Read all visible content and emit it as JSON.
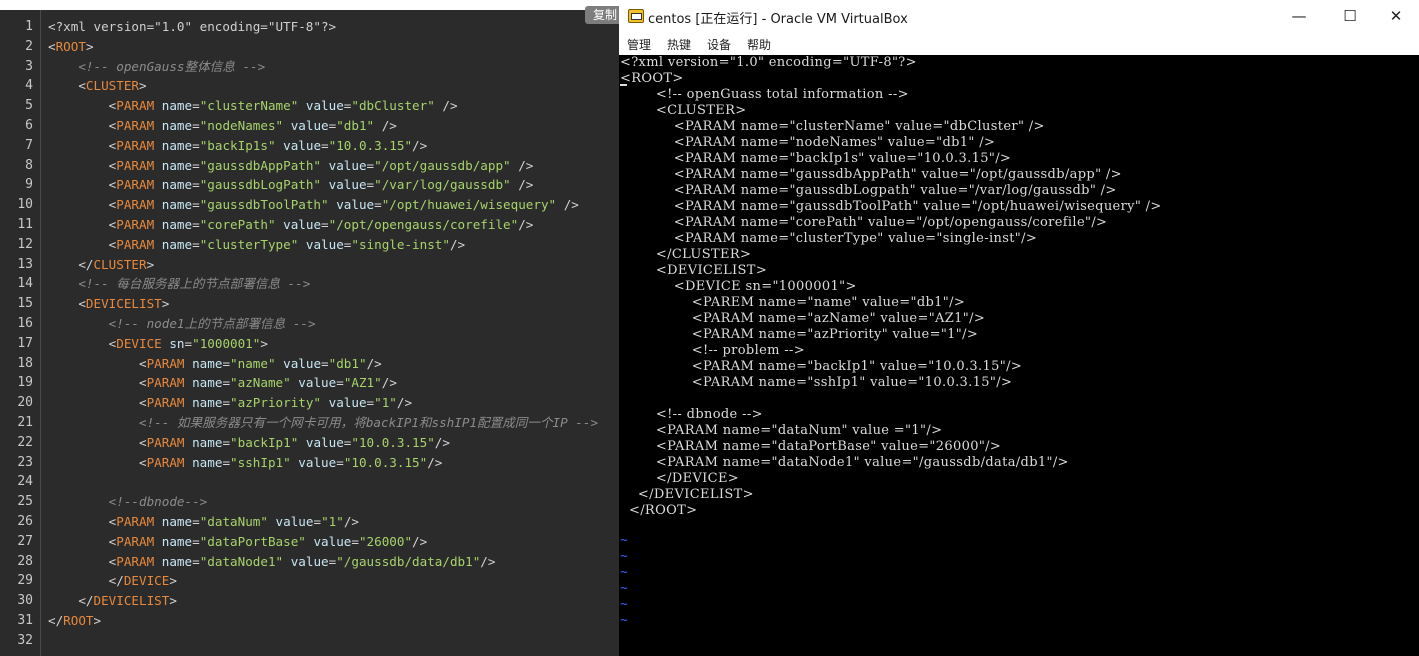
{
  "editor": {
    "copy_label": "复制",
    "line_numbers": [
      "1",
      "2",
      "3",
      "4",
      "5",
      "6",
      "7",
      "8",
      "9",
      "10",
      "11",
      "12",
      "13",
      "14",
      "15",
      "16",
      "17",
      "18",
      "19",
      "20",
      "21",
      "22",
      "23",
      "24",
      "25",
      "26",
      "27",
      "28",
      "29",
      "30",
      "31",
      "32"
    ],
    "lines": [
      [
        {
          "t": "decl",
          "s": "<?xml version=\"1.0\" encoding=\"UTF-8\"?>"
        }
      ],
      [
        {
          "t": "pl",
          "s": "<"
        },
        {
          "t": "tag",
          "s": "ROOT"
        },
        {
          "t": "pl",
          "s": ">"
        }
      ],
      [
        {
          "t": "pl",
          "s": "    "
        },
        {
          "t": "com",
          "s": "<!-- openGauss整体信息 -->"
        }
      ],
      [
        {
          "t": "pl",
          "s": "    <"
        },
        {
          "t": "tag",
          "s": "CLUSTER"
        },
        {
          "t": "pl",
          "s": ">"
        }
      ],
      [
        {
          "t": "pl",
          "s": "        <"
        },
        {
          "t": "tag",
          "s": "PARAM"
        },
        {
          "t": "pl",
          "s": " "
        },
        {
          "t": "attr",
          "s": "name"
        },
        {
          "t": "eq",
          "s": "="
        },
        {
          "t": "val",
          "s": "\"clusterName\""
        },
        {
          "t": "pl",
          "s": " "
        },
        {
          "t": "attr",
          "s": "value"
        },
        {
          "t": "eq",
          "s": "="
        },
        {
          "t": "val",
          "s": "\"dbCluster\""
        },
        {
          "t": "pl",
          "s": " />"
        }
      ],
      [
        {
          "t": "pl",
          "s": "        <"
        },
        {
          "t": "tag",
          "s": "PARAM"
        },
        {
          "t": "pl",
          "s": " "
        },
        {
          "t": "attr",
          "s": "name"
        },
        {
          "t": "eq",
          "s": "="
        },
        {
          "t": "val",
          "s": "\"nodeNames\""
        },
        {
          "t": "pl",
          "s": " "
        },
        {
          "t": "attr",
          "s": "value"
        },
        {
          "t": "eq",
          "s": "="
        },
        {
          "t": "val",
          "s": "\"db1\""
        },
        {
          "t": "pl",
          "s": " />"
        }
      ],
      [
        {
          "t": "pl",
          "s": "        <"
        },
        {
          "t": "tag",
          "s": "PARAM"
        },
        {
          "t": "pl",
          "s": " "
        },
        {
          "t": "attr",
          "s": "name"
        },
        {
          "t": "eq",
          "s": "="
        },
        {
          "t": "val",
          "s": "\"backIp1s\""
        },
        {
          "t": "pl",
          "s": " "
        },
        {
          "t": "attr",
          "s": "value"
        },
        {
          "t": "eq",
          "s": "="
        },
        {
          "t": "val",
          "s": "\"10.0.3.15\""
        },
        {
          "t": "pl",
          "s": "/>"
        }
      ],
      [
        {
          "t": "pl",
          "s": "        <"
        },
        {
          "t": "tag",
          "s": "PARAM"
        },
        {
          "t": "pl",
          "s": " "
        },
        {
          "t": "attr",
          "s": "name"
        },
        {
          "t": "eq",
          "s": "="
        },
        {
          "t": "val",
          "s": "\"gaussdbAppPath\""
        },
        {
          "t": "pl",
          "s": " "
        },
        {
          "t": "attr",
          "s": "value"
        },
        {
          "t": "eq",
          "s": "="
        },
        {
          "t": "val",
          "s": "\"/opt/gaussdb/app\""
        },
        {
          "t": "pl",
          "s": " />"
        }
      ],
      [
        {
          "t": "pl",
          "s": "        <"
        },
        {
          "t": "tag",
          "s": "PARAM"
        },
        {
          "t": "pl",
          "s": " "
        },
        {
          "t": "attr",
          "s": "name"
        },
        {
          "t": "eq",
          "s": "="
        },
        {
          "t": "val",
          "s": "\"gaussdbLogPath\""
        },
        {
          "t": "pl",
          "s": " "
        },
        {
          "t": "attr",
          "s": "value"
        },
        {
          "t": "eq",
          "s": "="
        },
        {
          "t": "val",
          "s": "\"/var/log/gaussdb\""
        },
        {
          "t": "pl",
          "s": " />"
        }
      ],
      [
        {
          "t": "pl",
          "s": "        <"
        },
        {
          "t": "tag",
          "s": "PARAM"
        },
        {
          "t": "pl",
          "s": " "
        },
        {
          "t": "attr",
          "s": "name"
        },
        {
          "t": "eq",
          "s": "="
        },
        {
          "t": "val",
          "s": "\"gaussdbToolPath\""
        },
        {
          "t": "pl",
          "s": " "
        },
        {
          "t": "attr",
          "s": "value"
        },
        {
          "t": "eq",
          "s": "="
        },
        {
          "t": "val",
          "s": "\"/opt/huawei/wisequery\""
        },
        {
          "t": "pl",
          "s": " />"
        }
      ],
      [
        {
          "t": "pl",
          "s": "        <"
        },
        {
          "t": "tag",
          "s": "PARAM"
        },
        {
          "t": "pl",
          "s": " "
        },
        {
          "t": "attr",
          "s": "name"
        },
        {
          "t": "eq",
          "s": "="
        },
        {
          "t": "val",
          "s": "\"corePath\""
        },
        {
          "t": "pl",
          "s": " "
        },
        {
          "t": "attr",
          "s": "value"
        },
        {
          "t": "eq",
          "s": "="
        },
        {
          "t": "val",
          "s": "\"/opt/opengauss/corefile\""
        },
        {
          "t": "pl",
          "s": "/>"
        }
      ],
      [
        {
          "t": "pl",
          "s": "        <"
        },
        {
          "t": "tag",
          "s": "PARAM"
        },
        {
          "t": "pl",
          "s": " "
        },
        {
          "t": "attr",
          "s": "name"
        },
        {
          "t": "eq",
          "s": "="
        },
        {
          "t": "val",
          "s": "\"clusterType\""
        },
        {
          "t": "pl",
          "s": " "
        },
        {
          "t": "attr",
          "s": "value"
        },
        {
          "t": "eq",
          "s": "="
        },
        {
          "t": "val",
          "s": "\"single-inst\""
        },
        {
          "t": "pl",
          "s": "/>"
        }
      ],
      [
        {
          "t": "pl",
          "s": "    </"
        },
        {
          "t": "tag",
          "s": "CLUSTER"
        },
        {
          "t": "pl",
          "s": ">"
        }
      ],
      [
        {
          "t": "pl",
          "s": "    "
        },
        {
          "t": "com",
          "s": "<!-- 每台服务器上的节点部署信息 -->"
        }
      ],
      [
        {
          "t": "pl",
          "s": "    <"
        },
        {
          "t": "tag",
          "s": "DEVICELIST"
        },
        {
          "t": "pl",
          "s": ">"
        }
      ],
      [
        {
          "t": "pl",
          "s": "        "
        },
        {
          "t": "com",
          "s": "<!-- node1上的节点部署信息 -->"
        }
      ],
      [
        {
          "t": "pl",
          "s": "        <"
        },
        {
          "t": "tag",
          "s": "DEVICE"
        },
        {
          "t": "pl",
          "s": " "
        },
        {
          "t": "attr",
          "s": "sn"
        },
        {
          "t": "eq",
          "s": "="
        },
        {
          "t": "val",
          "s": "\"1000001\""
        },
        {
          "t": "pl",
          "s": ">"
        }
      ],
      [
        {
          "t": "pl",
          "s": "            <"
        },
        {
          "t": "tag",
          "s": "PARAM"
        },
        {
          "t": "pl",
          "s": " "
        },
        {
          "t": "attr",
          "s": "name"
        },
        {
          "t": "eq",
          "s": "="
        },
        {
          "t": "val",
          "s": "\"name\""
        },
        {
          "t": "pl",
          "s": " "
        },
        {
          "t": "attr",
          "s": "value"
        },
        {
          "t": "eq",
          "s": "="
        },
        {
          "t": "val",
          "s": "\"db1\""
        },
        {
          "t": "pl",
          "s": "/>"
        }
      ],
      [
        {
          "t": "pl",
          "s": "            <"
        },
        {
          "t": "tag",
          "s": "PARAM"
        },
        {
          "t": "pl",
          "s": " "
        },
        {
          "t": "attr",
          "s": "name"
        },
        {
          "t": "eq",
          "s": "="
        },
        {
          "t": "val",
          "s": "\"azName\""
        },
        {
          "t": "pl",
          "s": " "
        },
        {
          "t": "attr",
          "s": "value"
        },
        {
          "t": "eq",
          "s": "="
        },
        {
          "t": "val",
          "s": "\"AZ1\""
        },
        {
          "t": "pl",
          "s": "/>"
        }
      ],
      [
        {
          "t": "pl",
          "s": "            <"
        },
        {
          "t": "tag",
          "s": "PARAM"
        },
        {
          "t": "pl",
          "s": " "
        },
        {
          "t": "attr",
          "s": "name"
        },
        {
          "t": "eq",
          "s": "="
        },
        {
          "t": "val",
          "s": "\"azPriority\""
        },
        {
          "t": "pl",
          "s": " "
        },
        {
          "t": "attr",
          "s": "value"
        },
        {
          "t": "eq",
          "s": "="
        },
        {
          "t": "val",
          "s": "\"1\""
        },
        {
          "t": "pl",
          "s": "/>"
        }
      ],
      [
        {
          "t": "pl",
          "s": "            "
        },
        {
          "t": "com",
          "s": "<!-- 如果服务器只有一个网卡可用，将backIP1和sshIP1配置成同一个IP -->"
        }
      ],
      [
        {
          "t": "pl",
          "s": "            <"
        },
        {
          "t": "tag",
          "s": "PARAM"
        },
        {
          "t": "pl",
          "s": " "
        },
        {
          "t": "attr",
          "s": "name"
        },
        {
          "t": "eq",
          "s": "="
        },
        {
          "t": "val",
          "s": "\"backIp1\""
        },
        {
          "t": "pl",
          "s": " "
        },
        {
          "t": "attr",
          "s": "value"
        },
        {
          "t": "eq",
          "s": "="
        },
        {
          "t": "val",
          "s": "\"10.0.3.15\""
        },
        {
          "t": "pl",
          "s": "/>"
        }
      ],
      [
        {
          "t": "pl",
          "s": "            <"
        },
        {
          "t": "tag",
          "s": "PARAM"
        },
        {
          "t": "pl",
          "s": " "
        },
        {
          "t": "attr",
          "s": "name"
        },
        {
          "t": "eq",
          "s": "="
        },
        {
          "t": "val",
          "s": "\"sshIp1\""
        },
        {
          "t": "pl",
          "s": " "
        },
        {
          "t": "attr",
          "s": "value"
        },
        {
          "t": "eq",
          "s": "="
        },
        {
          "t": "val",
          "s": "\"10.0.3.15\""
        },
        {
          "t": "pl",
          "s": "/>"
        }
      ],
      [
        {
          "t": "pl",
          "s": ""
        }
      ],
      [
        {
          "t": "pl",
          "s": "        "
        },
        {
          "t": "com",
          "s": "<!--dbnode-->"
        }
      ],
      [
        {
          "t": "pl",
          "s": "        <"
        },
        {
          "t": "tag",
          "s": "PARAM"
        },
        {
          "t": "pl",
          "s": " "
        },
        {
          "t": "attr",
          "s": "name"
        },
        {
          "t": "eq",
          "s": "="
        },
        {
          "t": "val",
          "s": "\"dataNum\""
        },
        {
          "t": "pl",
          "s": " "
        },
        {
          "t": "attr",
          "s": "value"
        },
        {
          "t": "eq",
          "s": "="
        },
        {
          "t": "val",
          "s": "\"1\""
        },
        {
          "t": "pl",
          "s": "/>"
        }
      ],
      [
        {
          "t": "pl",
          "s": "        <"
        },
        {
          "t": "tag",
          "s": "PARAM"
        },
        {
          "t": "pl",
          "s": " "
        },
        {
          "t": "attr",
          "s": "name"
        },
        {
          "t": "eq",
          "s": "="
        },
        {
          "t": "val",
          "s": "\"dataPortBase\""
        },
        {
          "t": "pl",
          "s": " "
        },
        {
          "t": "attr",
          "s": "value"
        },
        {
          "t": "eq",
          "s": "="
        },
        {
          "t": "val",
          "s": "\"26000\""
        },
        {
          "t": "pl",
          "s": "/>"
        }
      ],
      [
        {
          "t": "pl",
          "s": "        <"
        },
        {
          "t": "tag",
          "s": "PARAM"
        },
        {
          "t": "pl",
          "s": " "
        },
        {
          "t": "attr",
          "s": "name"
        },
        {
          "t": "eq",
          "s": "="
        },
        {
          "t": "val",
          "s": "\"dataNode1\""
        },
        {
          "t": "pl",
          "s": " "
        },
        {
          "t": "attr",
          "s": "value"
        },
        {
          "t": "eq",
          "s": "="
        },
        {
          "t": "val",
          "s": "\"/gaussdb/data/db1\""
        },
        {
          "t": "pl",
          "s": "/>"
        }
      ],
      [
        {
          "t": "pl",
          "s": "        </"
        },
        {
          "t": "tag",
          "s": "DEVICE"
        },
        {
          "t": "pl",
          "s": ">"
        }
      ],
      [
        {
          "t": "pl",
          "s": "    </"
        },
        {
          "t": "tag",
          "s": "DEVICELIST"
        },
        {
          "t": "pl",
          "s": ">"
        }
      ],
      [
        {
          "t": "pl",
          "s": "</"
        },
        {
          "t": "tag",
          "s": "ROOT"
        },
        {
          "t": "pl",
          "s": ">"
        }
      ],
      [
        {
          "t": "pl",
          "s": ""
        }
      ]
    ]
  },
  "vbox": {
    "title": "centos [正在运行] - Oracle VM VirtualBox",
    "icon": "virtualbox-icon",
    "window_controls": {
      "minimize": "—",
      "maximize": "☐",
      "close": "✕"
    },
    "menu": [
      "管理",
      "热键",
      "设备",
      "帮助"
    ],
    "terminal_lines": [
      "<?xml version=\"1.0\" encoding=\"UTF-8\"?>",
      "<ROOT>",
      "        <!-- openGuass total information -->",
      "        <CLUSTER>",
      "            <PARAM name=\"clusterName\" value=\"dbCluster\" />",
      "            <PARAM name=\"nodeNames\" value=\"db1\" />",
      "            <PARAM name=\"backIp1s\" value=\"10.0.3.15\"/>",
      "            <PARAM name=\"gaussdbAppPath\" value=\"/opt/gaussdb/app\" />",
      "            <PARAM name=\"gaussdbLogpath\" value=\"/var/log/gaussdb\" />",
      "            <PARAM name=\"gaussdbToolPath\" value=\"/opt/huawei/wisequery\" />",
      "            <PARAM name=\"corePath\" value=\"/opt/opengauss/corefile\"/>",
      "            <PARAM name=\"clusterType\" value=\"single-inst\"/>",
      "        </CLUSTER>",
      "        <DEVICELIST>",
      "            <DEVICE sn=\"1000001\">",
      "                <PAREM name=\"name\" value=\"db1\"/>",
      "                <PARAM name=\"azName\" value=\"AZ1\"/>",
      "                <PARAM name=\"azPriority\" value=\"1\"/>",
      "                <!-- problem -->",
      "                <PARAM name=\"backIp1\" value=\"10.0.3.15\"/>",
      "                <PARAM name=\"sshIp1\" value=\"10.0.3.15\"/>",
      "",
      "        <!-- dbnode -->",
      "        <PARAM name=\"dataNum\" value =\"1\"/>",
      "        <PARAM name=\"dataPortBase\" value=\"26000\"/>",
      "        <PARAM name=\"dataNode1\" value=\"/gaussdb/data/db1\"/>",
      "        </DEVICE>",
      "    </DEVICELIST>",
      "  </ROOT>"
    ],
    "tildes": [
      "~",
      "~",
      "~",
      "~",
      "~",
      "~"
    ]
  }
}
